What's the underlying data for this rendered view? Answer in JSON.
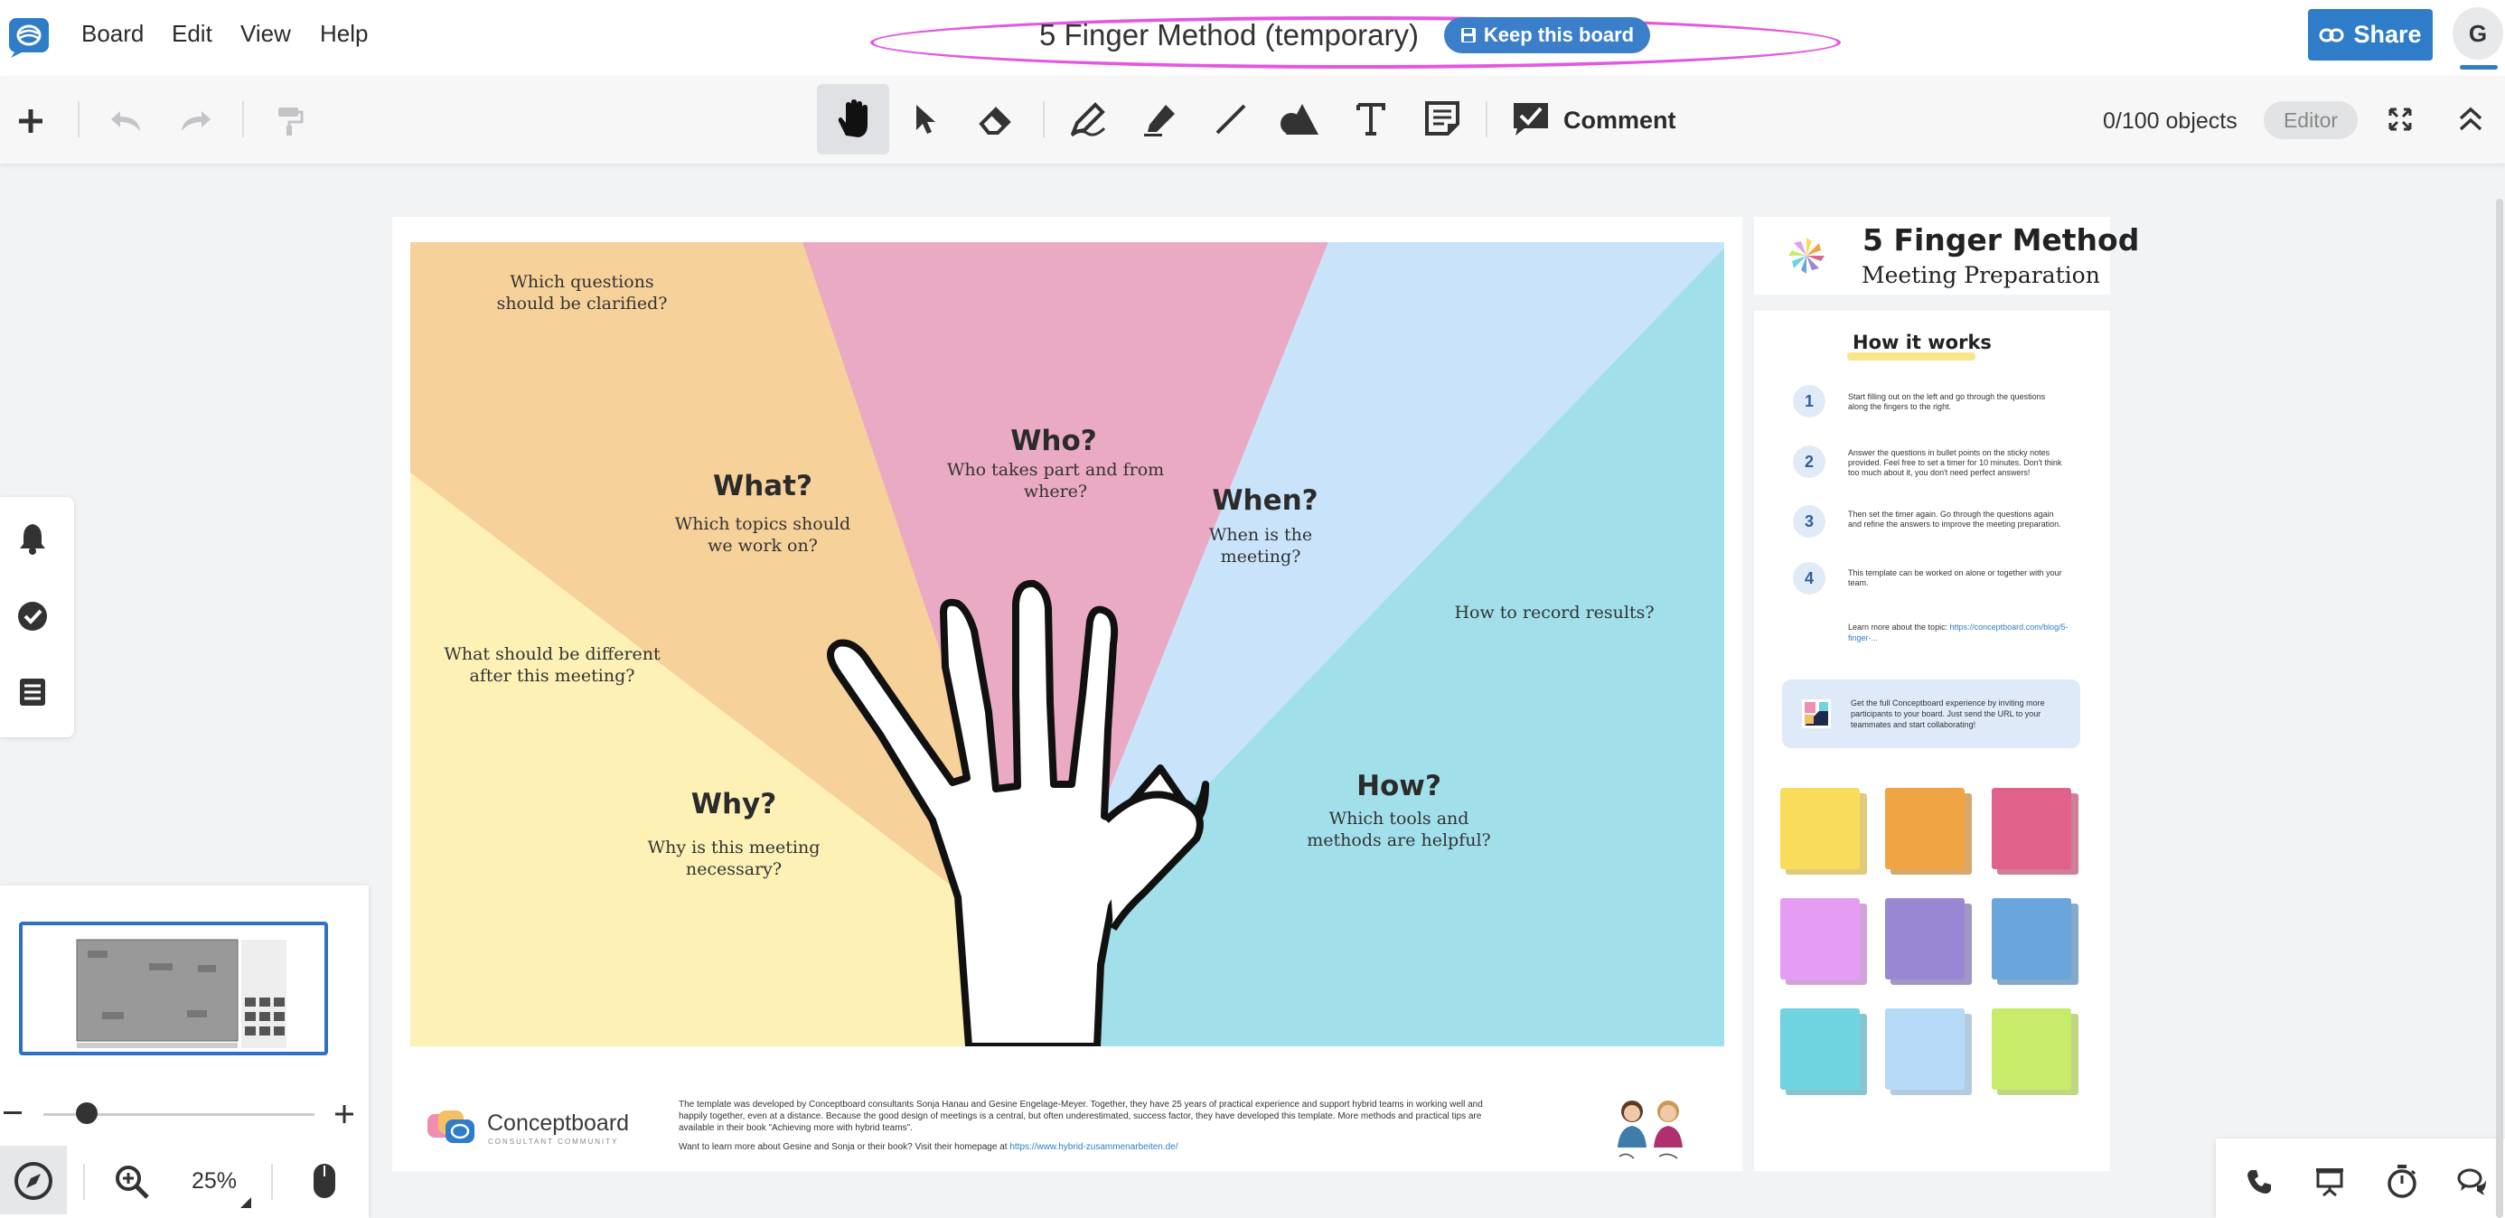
{
  "menu": {
    "board": "Board",
    "edit": "Edit",
    "view": "View",
    "help": "Help"
  },
  "header": {
    "title": "5 Finger Method (temporary)",
    "keep_label": "Keep this board",
    "share_label": "Share",
    "avatar_initial": "G"
  },
  "toolbar": {
    "comment_label": "Comment",
    "objects_count": "0/100 objects",
    "role_badge": "Editor"
  },
  "canvas": {
    "q_clarified": "Which questions\nshould be clarified?",
    "what_head": "What?",
    "what_sub": "Which topics should\nwe work on?",
    "who_head": "Who?",
    "who_sub": "Who takes part and from\nwhere?",
    "when_head": "When?",
    "when_sub": "When is the\nmeeting?",
    "record": "How to record results?",
    "different": "What should be different\nafter this meeting?",
    "why_head": "Why?",
    "why_sub": "Why is this meeting\nnecessary?",
    "how_head": "How?",
    "how_sub": "Which tools and\nmethods are helpful?",
    "colors": {
      "orange": "#f7d19a",
      "pink": "#eaaac4",
      "blue": "#c9e4fa",
      "cyan": "#a1e0ea",
      "yellow": "#fdf1b6"
    }
  },
  "footer": {
    "brand": "Conceptboard",
    "brand_sub": "CONSULTANT COMMUNITY",
    "text": "The template was developed by Conceptboard consultants Sonja Hanau and Gesine Engelage-Meyer. Together, they have 25 years of practical experience and support hybrid teams in working well and happily together, even at a distance. Because the good design of meetings is a central, but often underestimated, success factor, they have developed this template. More methods and practical tips are available in their book \"Achieving more with hybrid teams\".",
    "text2": "Want to learn more about Gesine and Sonja or their book? Visit their homepage at ",
    "link": "https://www.hybrid-zusammenarbeiten.de/"
  },
  "panel": {
    "title": "5 Finger Method",
    "subtitle": "Meeting Preparation",
    "how_it_works": "How it works",
    "steps": [
      {
        "num": "1",
        "text": "Start filling out on the left and go through the questions along the fingers to the right."
      },
      {
        "num": "2",
        "text": "Answer the questions in bullet points on the sticky notes provided. Feel free to set a timer for 10 minutes. Don't think too much about it, you don't need perfect answers!"
      },
      {
        "num": "3",
        "text": "Then set the timer again. Go through the questions again and refine the answers to improve the meeting preparation."
      },
      {
        "num": "4",
        "text": "This template can be worked on alone or together with your team."
      }
    ],
    "learn_text": "Learn more about the topic: ",
    "learn_link": "https://conceptboard.com/blog/5-finger-...",
    "promo": "Get the full Conceptboard experience by inviting more participants to your board. Just send the URL to your teammates and start collaborating!",
    "sticky_colors": [
      "#f9dc5c",
      "#f0a444",
      "#e0628a",
      "#e59cf3",
      "#9a87d4",
      "#6aa6dc",
      "#6fd3e0",
      "#b6daf8",
      "#c8ec6a"
    ]
  },
  "zoom": {
    "level": "25%",
    "fraction": 0.16
  }
}
